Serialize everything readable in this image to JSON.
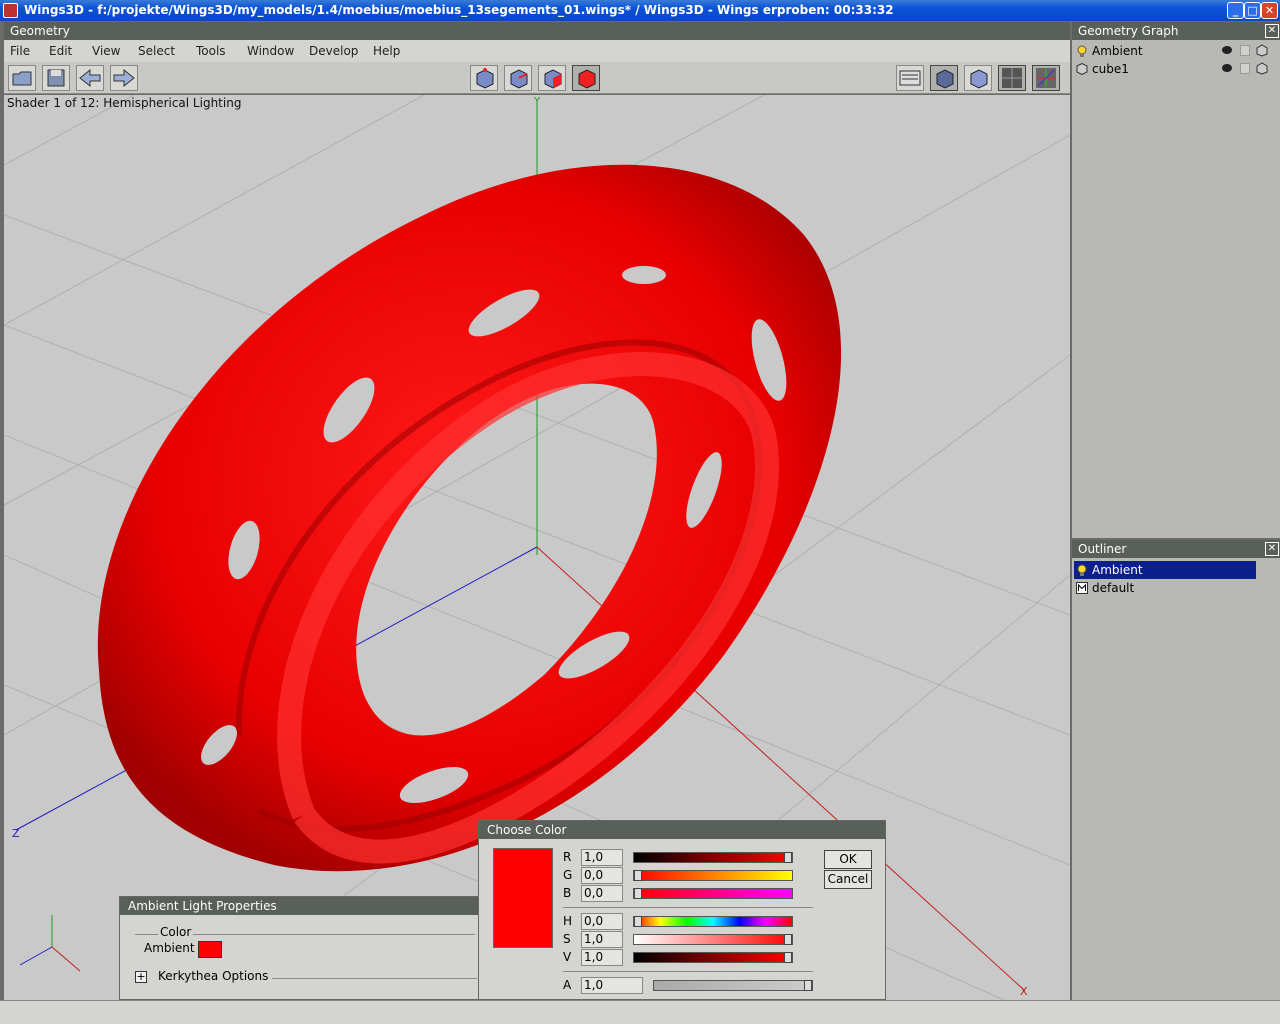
{
  "app": {
    "title": "Wings3D - f:/projekte/Wings3D/my_models/1.4/moebius/moebius_13segements_01.wings* / Wings3D - Wings erproben: 00:33:32"
  },
  "geometry": {
    "header": "Geometry",
    "menu": [
      "File",
      "Edit",
      "View",
      "Select",
      "Tools",
      "Window",
      "Develop",
      "Help"
    ],
    "shader_info": "Shader 1 of 12: Hemispherical Lighting",
    "axis_labels": {
      "y": "Y",
      "z": "Z",
      "x": "X"
    },
    "model_color": "#ff0000"
  },
  "geometry_graph": {
    "header": "Geometry Graph",
    "items": [
      {
        "label": "Ambient",
        "icon": "lightbulb-icon"
      },
      {
        "label": "cube1",
        "icon": "cube-icon"
      }
    ]
  },
  "outliner": {
    "header": "Outliner",
    "items": [
      {
        "label": "Ambient",
        "icon": "lightbulb-icon",
        "selected": true
      },
      {
        "label": "default",
        "icon": "material-icon",
        "selected": false
      }
    ]
  },
  "ambient_props": {
    "header": "Ambient Light Properties",
    "group": "Color",
    "ambient_label": "Ambient",
    "ambient_color": "#ff0000",
    "options_label": "Kerkythea Options"
  },
  "choose_color": {
    "header": "Choose Color",
    "color": "#ff0000",
    "channels": [
      {
        "label": "R",
        "value": "1,0",
        "level": 1.0
      },
      {
        "label": "G",
        "value": "0,0",
        "level": 0.0
      },
      {
        "label": "B",
        "value": "0,0",
        "level": 0.0
      },
      {
        "label": "H",
        "value": "0,0",
        "level": 0.0
      },
      {
        "label": "S",
        "value": "1,0",
        "level": 1.0
      },
      {
        "label": "V",
        "value": "1,0",
        "level": 1.0
      }
    ],
    "alpha": {
      "label": "A",
      "value": "1,0",
      "level": 1.0
    },
    "ok": "OK",
    "cancel": "Cancel"
  }
}
